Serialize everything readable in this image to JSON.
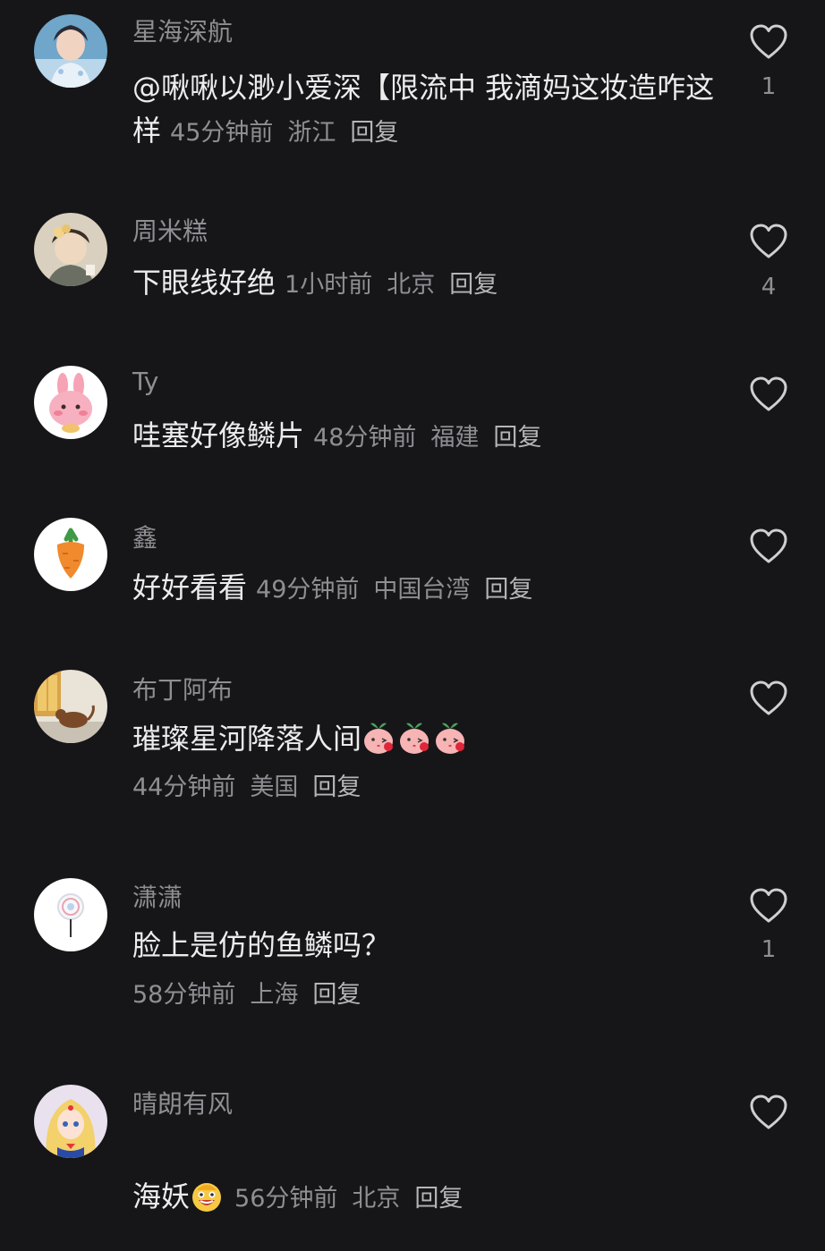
{
  "comments": [
    {
      "username": "星海深航",
      "text": "@啾啾以渺小爱深【限流中 我滴妈这妆造咋这样",
      "time": "45分钟前",
      "location": "浙江",
      "reply_label": "回复",
      "likes": "1",
      "avatar_icon": "avatar-photo-icon"
    },
    {
      "username": "周米糕",
      "text": "下眼线好绝",
      "time": "1小时前",
      "location": "北京",
      "reply_label": "回复",
      "likes": "4",
      "avatar_icon": "avatar-photo-icon"
    },
    {
      "username": "Ty",
      "text": "哇塞好像鳞片",
      "time": "48分钟前",
      "location": "福建",
      "reply_label": "回复",
      "likes": "",
      "avatar_icon": "pink-bunny-icon"
    },
    {
      "username": "鑫",
      "text": "好好看看",
      "time": "49分钟前",
      "location": "中国台湾",
      "reply_label": "回复",
      "likes": "",
      "avatar_icon": "carrot-icon"
    },
    {
      "username": "布丁阿布",
      "text": "璀璨星河降落人间",
      "time": "44分钟前",
      "location": "美国",
      "reply_label": "回复",
      "likes": "",
      "avatar_icon": "cat-photo-icon",
      "emojis": [
        "peach-kiss-emoji",
        "peach-kiss-emoji",
        "peach-kiss-emoji"
      ]
    },
    {
      "username": "潇潇",
      "text": "脸上是仿的鱼鳞吗？",
      "time": "58分钟前",
      "location": "上海",
      "reply_label": "回复",
      "likes": "1",
      "avatar_icon": "lollipop-icon"
    },
    {
      "username": "晴朗有风",
      "text": "海妖",
      "time": "56分钟前",
      "location": "北京",
      "reply_label": "回复",
      "likes": "",
      "avatar_icon": "anime-girl-icon",
      "emojis": [
        "grinning-emoji"
      ]
    }
  ],
  "colors": {
    "background": "#161619",
    "text": "#ececec",
    "secondary": "#8e8e93"
  }
}
